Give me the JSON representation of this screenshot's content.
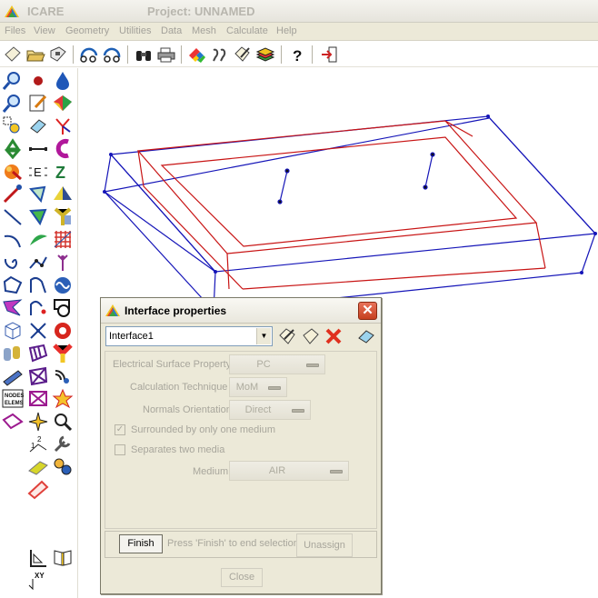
{
  "app": {
    "name": "ICARE",
    "project_title": "Project: UNNAMED",
    "accent": "#0a246a"
  },
  "menu": {
    "items": [
      {
        "label": "Files"
      },
      {
        "label": "View"
      },
      {
        "label": "Geometry"
      },
      {
        "label": "Utilities"
      },
      {
        "label": "Data"
      },
      {
        "label": "Mesh"
      },
      {
        "label": "Calculate"
      },
      {
        "label": "Help"
      }
    ]
  },
  "toolbar": {
    "buttons": [
      "new-icon",
      "open-folder-icon",
      "save-disk-icon",
      "rotate-left-icon",
      "rotate-right-icon",
      "binoculars-icon",
      "printer-icon",
      "color-pencil-icon",
      "walk-icon",
      "edit-note-icon",
      "layers-icon",
      "help-question-icon",
      "exit-icon"
    ]
  },
  "palette": {
    "icons": [
      "zoom-magnifier-icon",
      "red-dot-icon",
      "drop-icon",
      "zoom-fit-icon",
      "notepad-pencil-icon",
      "shade-surface-icon",
      "zoom-box-icon",
      "eraser-icon",
      "axis-y-icon",
      "recycle-icon",
      "segment-icon",
      "magnet-icon",
      "sphere-icon",
      "e-points-icon",
      "z-letter-icon",
      "arrow-vector-icon",
      "polygon-pick-icon",
      "surface-shade-icon",
      "line-icon",
      "fill-triangle-icon",
      "y-surface-icon",
      "arc-icon",
      "leaf-surface-icon",
      "grid-mesh-icon",
      "spiral-icon",
      "connected-points-icon",
      "antenna-icon",
      "square-points-icon",
      "node-arc-icon",
      "sine-wave-icon",
      "star-shape-icon",
      "curve-point-icon",
      "circle-cut-icon",
      "cube-icon",
      "scissors-icon",
      "target-red-icon",
      "cylinders-icon",
      "ribbon-mesh-icon",
      "y-gradient-icon",
      "plane-icon",
      "surface-mesh-icon",
      "wifi-wave-icon",
      "nodes-elems-icon",
      "cross-mesh-icon",
      "flower-mesh-icon",
      "loop-triangle-icon",
      "star-burst-icon",
      "magnify-mesh-icon",
      "numbered-points-icon",
      "wrench-icon",
      "yellow-surface-icon",
      "gear-assembly-icon",
      "ruler-icon",
      "measure-icon",
      "axis-xy-icon",
      "book-icon"
    ]
  },
  "dialog": {
    "title": "Interface properties",
    "close_glyph": "✕",
    "selected_interface": "Interface1",
    "fields": {
      "electrical_surface_property": {
        "label": "Electrical Surface Property",
        "value": "PC"
      },
      "calculation_technique": {
        "label": "Calculation Technique",
        "value": "MoM"
      },
      "normals_orientation": {
        "label": "Normals Orientation",
        "value": "Direct"
      },
      "surrounded_one_medium": {
        "label": "Surrounded by only one medium",
        "checked": true
      },
      "separates_two_media": {
        "label": "Separates two media",
        "checked": false
      },
      "medium": {
        "label": "Medium",
        "value": "AIR"
      }
    },
    "finish_label": "Finish",
    "finish_hint": "Press 'Finish' to end selection",
    "unassign_label": "Unassign",
    "close_label": "Close"
  },
  "viewport": {
    "blue_color": "#1515b8",
    "red_color": "#c81414"
  }
}
